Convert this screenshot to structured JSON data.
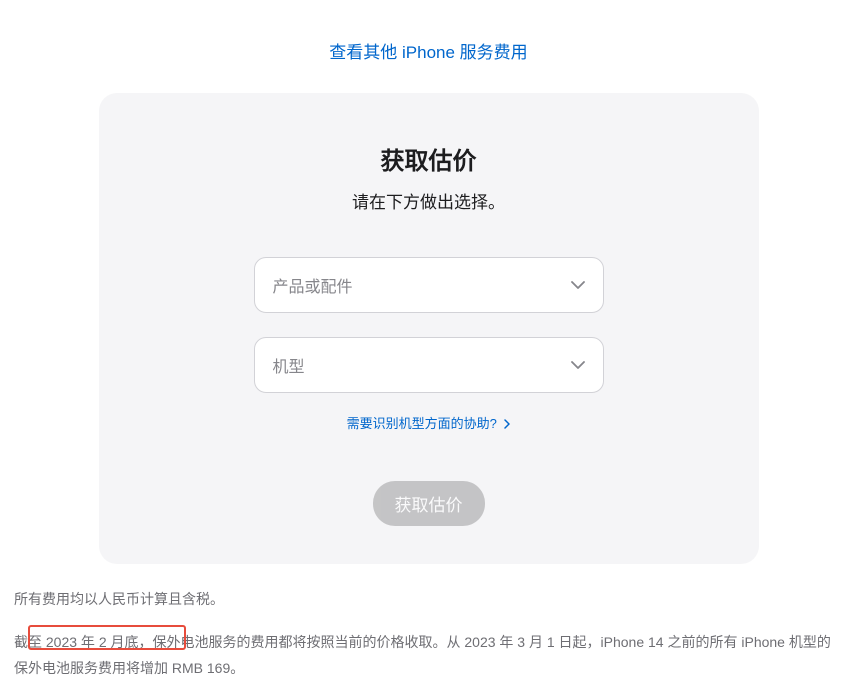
{
  "topLink": "查看其他 iPhone 服务费用",
  "card": {
    "title": "获取估价",
    "subtitle": "请在下方做出选择。",
    "select1": {
      "placeholder": "产品或配件"
    },
    "select2": {
      "placeholder": "机型"
    },
    "helpLink": "需要识别机型方面的协助?",
    "buttonLabel": "获取估价"
  },
  "footer": {
    "line1": "所有费用均以人民币计算且含税。",
    "line2": "截至 2023 年 2 月底，保外电池服务的费用都将按照当前的价格收取。从 2023 年 3 月 1 日起，iPhone 14 之前的所有 iPhone 机型的保外电池服务费用将增加 RMB 169。"
  }
}
